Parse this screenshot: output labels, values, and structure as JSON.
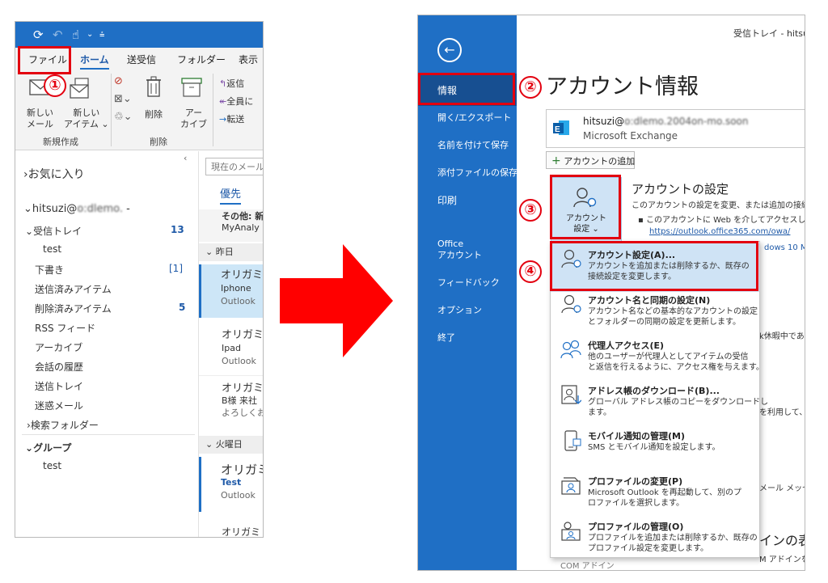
{
  "left": {
    "tabs": [
      "ファイル",
      "ホーム",
      "送受信",
      "フォルダー",
      "表示"
    ],
    "ribbon": {
      "new_mail": [
        "新しい",
        "メール"
      ],
      "new_item": [
        "新しい",
        "アイテム"
      ],
      "delete": "削除",
      "archive": [
        "アー",
        "カイブ"
      ],
      "reply": "返信",
      "reply_all": "全員に",
      "forward": "転送",
      "group_new": "新規作成",
      "group_delete": "削除"
    },
    "folders": {
      "favorites": "お気に入り",
      "account": "hitsuzi@",
      "account_blur": "o:dlemo.",
      "inbox": "受信トレイ",
      "inbox_count": "13",
      "test": "test",
      "drafts": "下書き",
      "drafts_count": "[1]",
      "sent": "送信済みアイテム",
      "deleted": "削除済みアイテム",
      "deleted_count": "5",
      "rss": "RSS フィード",
      "archive": "アーカイブ",
      "history": "会話の履歴",
      "outbox": "送信トレイ",
      "junk": "迷惑メール",
      "search": "検索フォルダー",
      "groups": "グループ",
      "group_test": "test"
    },
    "mail": {
      "search_placeholder": "現在のメール",
      "focus_tab": "優先",
      "other1": "その他: 新",
      "other2": "MyAnaly",
      "yesterday": "昨日",
      "m1_from": "オリガミ",
      "m1_sub": "Iphone",
      "m1_pre": "Outlook",
      "m2_from": "オリガミ",
      "m2_sub": "Ipad",
      "m2_pre": "Outlook",
      "m3_from": "オリガミ",
      "m3_sub": "B様 来社",
      "m3_pre": "よろしくお",
      "tuesday": "火曜日",
      "m4_from": "オリガミ",
      "m4_sub": "Test",
      "m4_pre": "Outlook",
      "m5_from": "オリガミ"
    }
  },
  "right": {
    "window_title": "受信トレイ - hitsuz",
    "nav": [
      "情報",
      "開く/エクスポート",
      "名前を付けて保存",
      "添付ファイルの保存",
      "印刷",
      "Office アカウント",
      "フィードバック",
      "オプション",
      "終了"
    ],
    "office_account": [
      "Office",
      "アカウント"
    ],
    "page_title": "アカウント情報",
    "account_email": "hitsuzi@",
    "account_blur": "o:dlemo.2004on-mo.soon",
    "account_type": "Microsoft Exchange",
    "add_account": "アカウントの追加",
    "settings_btn": [
      "アカウント",
      "設定"
    ],
    "settings_title": "アカウントの設定",
    "settings_desc": "このアカウントの設定を変更、または追加の接続を",
    "settings_bullet": "このアカウントに Web を介してアクセスします。",
    "settings_link": "https://outlook.office365.com/owa/",
    "side_frag1": "dows 10 M",
    "side_frag2": "k休暇中であ",
    "side_frag3": "を利用して、",
    "side_frag4": "メール メッセ",
    "side_frag5": "インの表",
    "side_frag6": "M アドインを",
    "dropdown": [
      {
        "title": "アカウント設定(A)...",
        "desc": [
          "アカウントを追加または削除するか、既存の",
          "接続設定を変更します。"
        ]
      },
      {
        "title": "アカウント名と同期の設定(N)",
        "desc": [
          "アカウント名などの基本的なアカウントの設定",
          "とフォルダーの同期の設定を更新します。"
        ]
      },
      {
        "title": "代理人アクセス(E)",
        "desc": [
          "他のユーザーが代理人としてアイテムの受信",
          "と返信を行えるように、アクセス権を与えます。"
        ]
      },
      {
        "title": "アドレス帳のダウンロード(B)...",
        "desc": [
          "グローバル アドレス帳のコピーをダウンロードし",
          "ます。"
        ]
      },
      {
        "title": "モバイル通知の管理(M)",
        "desc": [
          "SMS とモバイル通知を設定します。"
        ]
      },
      {
        "title": "プロファイルの変更(P)",
        "desc": [
          "Microsoft Outlook を再起動して、別のプ",
          "ロファイルを選択します。"
        ]
      },
      {
        "title": "プロファイルの管理(O)",
        "desc": [
          "プロファイルを追加または削除するか、既存の",
          "プロファイル設定を変更します。"
        ]
      }
    ],
    "bottom_frag": "COM アドイン"
  },
  "steps": [
    "①",
    "②",
    "③",
    "④"
  ],
  "colors": {
    "outlook_blue": "#1f6fc5",
    "highlight_red": "#e3000f",
    "arrow_red": "#ff0000"
  }
}
